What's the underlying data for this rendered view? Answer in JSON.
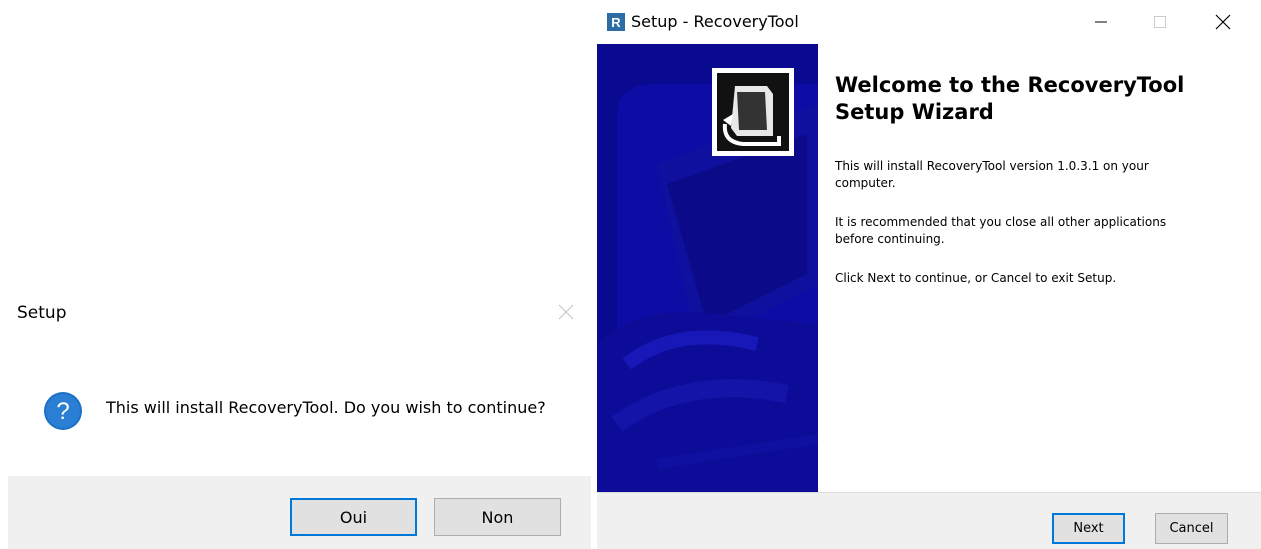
{
  "msgbox": {
    "title": "Setup",
    "message": "This will install RecoveryTool. Do you wish to continue?",
    "question_glyph": "?",
    "yes_label": "Oui",
    "no_label": "Non",
    "icon": "question-icon"
  },
  "wizard": {
    "window_title": "Setup - RecoveryTool",
    "app_icon_letter": "R",
    "heading_line1": "Welcome to the RecoveryTool",
    "heading_line2": "Setup Wizard",
    "para1_line1": "This will install RecoveryTool version 1.0.3.1 on your",
    "para1_line2": "computer.",
    "para2_line1": "It is recommended that you close all other applications",
    "para2_line2": "before continuing.",
    "para3": "Click Next to continue, or Cancel to exit Setup.",
    "next_label": "Next",
    "cancel_label": "Cancel",
    "colors": {
      "sidebar": "#0a0a90",
      "accent": "#0078d7",
      "footer": "#f0f0f0"
    }
  }
}
